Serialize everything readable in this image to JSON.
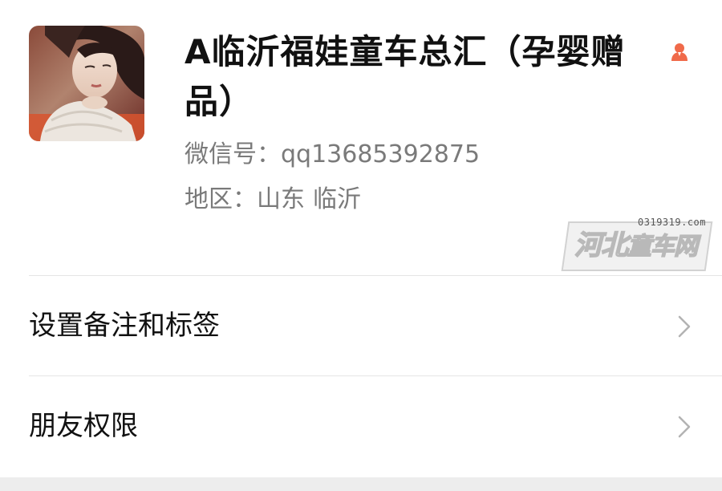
{
  "profile": {
    "name": "A临沂福娃童车总汇（孕婴赠品）",
    "wechat_id": "微信号：qq13685392875",
    "region_label": "地区：",
    "region_province": "山东",
    "region_city": "临沂",
    "gender_icon": "user-gender-icon",
    "gender_color": "#f06a4a"
  },
  "watermark": {
    "domain": "0319319.com",
    "text_big": "河北",
    "text_small": "童车网"
  },
  "menu": [
    {
      "label": "设置备注和标签",
      "icon": "chevron-right-icon"
    },
    {
      "label": "朋友权限",
      "icon": "chevron-right-icon"
    }
  ]
}
